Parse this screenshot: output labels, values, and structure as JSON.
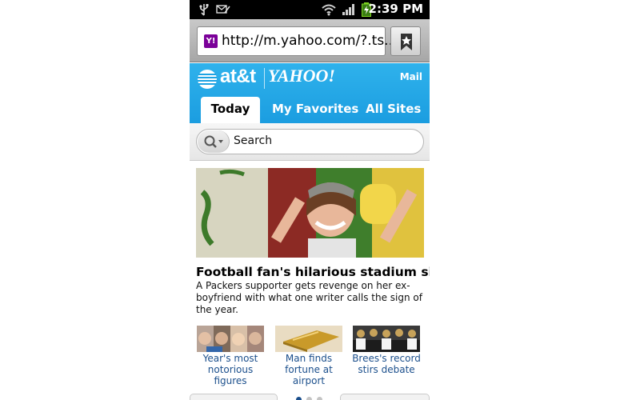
{
  "status_bar": {
    "time": "2:39 PM",
    "icons": [
      "usb-icon",
      "voicemail-icon",
      "wifi-icon",
      "signal-icon",
      "battery-icon"
    ]
  },
  "browser": {
    "url": "http://m.yahoo.com/?.ts...",
    "favicon_text": "Y!"
  },
  "header": {
    "att_logo_text": "at&t",
    "yahoo_logo_text": "YAHOO!",
    "mail_label": "Mail",
    "tabs": [
      {
        "label": "Today",
        "active": true
      },
      {
        "label": "My Favorites",
        "active": false
      },
      {
        "label": "All Sites",
        "active": false
      }
    ],
    "accent_color": "#1da1e2"
  },
  "search": {
    "placeholder": "Search"
  },
  "hero": {
    "title": "Football fan's hilarious stadium sign",
    "summary": "A Packers supporter gets revenge on her ex-boyfriend with what one writer calls the sign of the year."
  },
  "thumbnails": [
    {
      "caption": "Year's most notorious figures"
    },
    {
      "caption": "Man finds fortune at airport"
    },
    {
      "caption": "Brees's record stirs debate"
    }
  ],
  "pager": {
    "active_index": 0,
    "count": 3
  }
}
